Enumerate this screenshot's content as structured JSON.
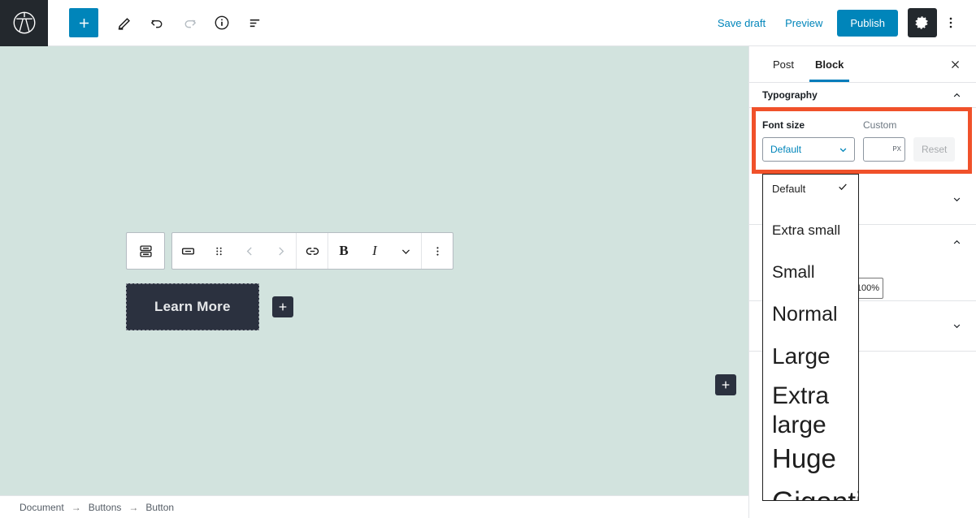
{
  "header": {
    "logo_icon": "wordpress-logo-icon",
    "add_block_icon": "plus-icon",
    "tools": [
      {
        "name": "edit-pencil-icon",
        "disabled": false
      },
      {
        "name": "undo-icon",
        "disabled": false
      },
      {
        "name": "redo-icon",
        "disabled": true
      },
      {
        "name": "info-icon",
        "disabled": false
      },
      {
        "name": "block-navigation-icon",
        "disabled": false
      }
    ],
    "save_draft_label": "Save draft",
    "preview_label": "Preview",
    "publish_label": "Publish",
    "settings_icon": "gear-icon",
    "more_icon": "kebab-menu-icon",
    "accent_color": "#0085ba",
    "logo_bg": "#23282d"
  },
  "canvas": {
    "background_color": "#d2e3de",
    "button_block": {
      "label": "Learn More",
      "background_color": "#2b313f",
      "text_color": "#e6e8ea"
    },
    "appender_icon": "plus-icon",
    "inserter_icon": "plus-icon"
  },
  "block_toolbar": {
    "parent_block_icon": "buttons-block-icon",
    "items": [
      {
        "name": "button-block-icon",
        "disabled": false
      },
      {
        "name": "drag-handle-icon",
        "disabled": false
      },
      {
        "name": "move-up-icon",
        "disabled": true
      },
      {
        "name": "move-down-icon",
        "disabled": true
      },
      {
        "name": "link-icon",
        "disabled": false
      },
      {
        "name": "bold-icon",
        "label": "B",
        "disabled": false
      },
      {
        "name": "italic-icon",
        "label": "I",
        "disabled": false
      },
      {
        "name": "more-rich-text-icon",
        "disabled": false
      },
      {
        "name": "block-options-icon",
        "disabled": false
      }
    ]
  },
  "footer": {
    "breadcrumb": [
      "Document",
      "Buttons",
      "Button"
    ],
    "separator": "→"
  },
  "sidebar": {
    "tabs": [
      {
        "label": "Post",
        "active": false
      },
      {
        "label": "Block",
        "active": true
      }
    ],
    "close_icon": "close-icon",
    "typography_panel": {
      "title": "Typography",
      "expanded": true,
      "chevron_icon": "chevron-up-icon",
      "font_size_label": "Font size",
      "font_size_value": "Default",
      "select_chevron_icon": "chevron-down-icon",
      "custom_label": "Custom",
      "custom_value": "",
      "custom_unit": "px",
      "reset_label": "Reset",
      "reset_disabled": true
    },
    "collapsed_panels": [
      {
        "chevron_icon": "chevron-down-icon"
      },
      {
        "chevron_icon": "chevron-up-icon"
      },
      {
        "chevron_icon": "chevron-down-icon"
      }
    ],
    "width_value": "100%",
    "highlight_color": "#f0512a"
  },
  "font_size_dropdown": {
    "open": true,
    "selected": "Default",
    "check_icon": "checkmark-icon",
    "options": [
      {
        "label": "Default",
        "px": 13,
        "selected": true
      },
      {
        "label": "Extra small",
        "px": 17,
        "selected": false
      },
      {
        "label": "Small",
        "px": 21,
        "selected": false
      },
      {
        "label": "Normal",
        "px": 25,
        "selected": false
      },
      {
        "label": "Large",
        "px": 28,
        "selected": false
      },
      {
        "label": "Extra large",
        "px": 30,
        "selected": false
      },
      {
        "label": "Huge",
        "px": 33,
        "selected": false
      },
      {
        "label": "Gigantic",
        "px": 35,
        "selected": false
      }
    ]
  }
}
